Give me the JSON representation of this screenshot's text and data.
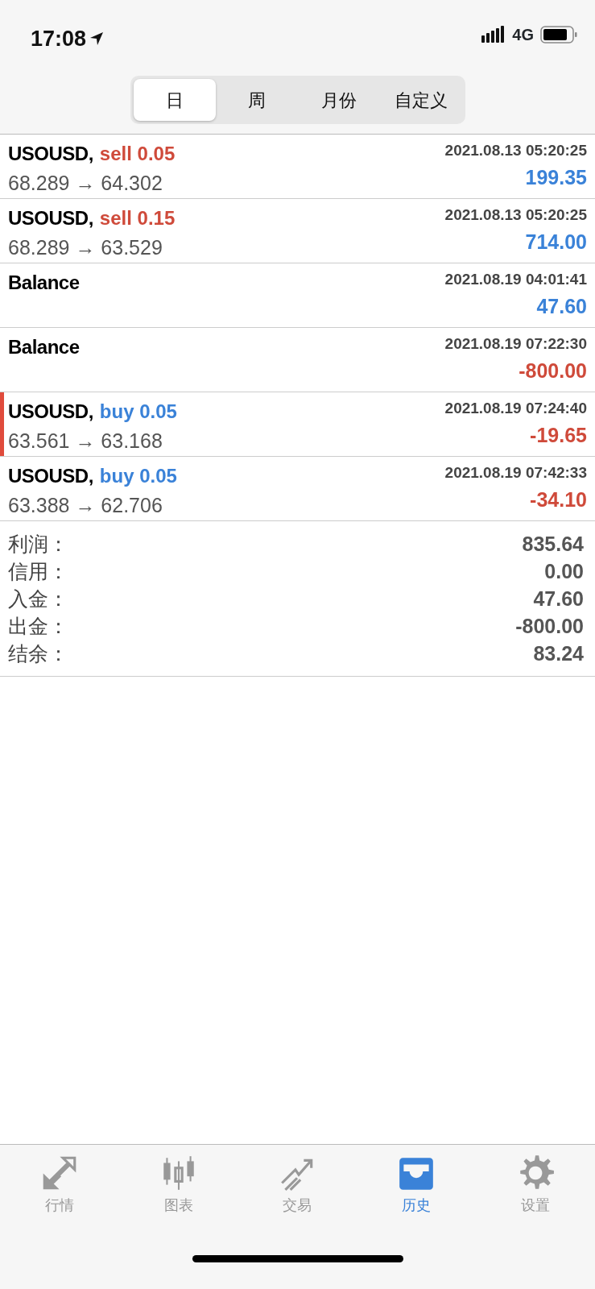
{
  "status_bar": {
    "time": "17:08",
    "network": "4G"
  },
  "tabs": [
    {
      "label": "日",
      "selected": true
    },
    {
      "label": "周",
      "selected": false
    },
    {
      "label": "月份",
      "selected": false
    },
    {
      "label": "自定义",
      "selected": false
    }
  ],
  "rows": [
    {
      "title": "USOUSD,",
      "side": {
        "text": "sell 0.05",
        "color": "#cf4a3a"
      },
      "prices": "68.289 → 64.302",
      "time": "2021.08.13 05:20:25",
      "profit": {
        "text": "199.35",
        "color": "#3a82d8"
      },
      "selected": false
    },
    {
      "title": "USOUSD,",
      "side": {
        "text": "sell 0.15",
        "color": "#cf4a3a"
      },
      "prices": "68.289 → 63.529",
      "time": "2021.08.13 05:20:25",
      "profit": {
        "text": "714.00",
        "color": "#3a82d8"
      },
      "selected": false
    },
    {
      "title": "Balance",
      "time": "2021.08.19 04:01:41",
      "profit": {
        "text": "47.60",
        "color": "#3a82d8"
      },
      "selected": false
    },
    {
      "title": "Balance",
      "time": "2021.08.19 07:22:30",
      "profit": {
        "text": "-800.00",
        "color": "#cf4a3a"
      },
      "selected": false
    },
    {
      "title": "USOUSD,",
      "side": {
        "text": "buy 0.05",
        "color": "#3a82d8"
      },
      "prices": "63.561 → 63.168",
      "time": "2021.08.19 07:24:40",
      "profit": {
        "text": "-19.65",
        "color": "#cf4a3a"
      },
      "selected": true
    },
    {
      "title": "USOUSD,",
      "side": {
        "text": "buy 0.05",
        "color": "#3a82d8"
      },
      "prices": "63.388 → 62.706",
      "time": "2021.08.19 07:42:33",
      "profit": {
        "text": "-34.10",
        "color": "#cf4a3a"
      },
      "selected": false
    }
  ],
  "summary": [
    {
      "label": "利润：",
      "value": "835.64"
    },
    {
      "label": "信用：",
      "value": "0.00"
    },
    {
      "label": "入金：",
      "value": "47.60"
    },
    {
      "label": "出金：",
      "value": "-800.00"
    },
    {
      "label": "结余：",
      "value": "83.24"
    }
  ],
  "bottom_nav": [
    {
      "label": "行情",
      "selected": false
    },
    {
      "label": "图表",
      "selected": false
    },
    {
      "label": "交易",
      "selected": false
    },
    {
      "label": "历史",
      "selected": true
    },
    {
      "label": "设置",
      "selected": false
    }
  ]
}
